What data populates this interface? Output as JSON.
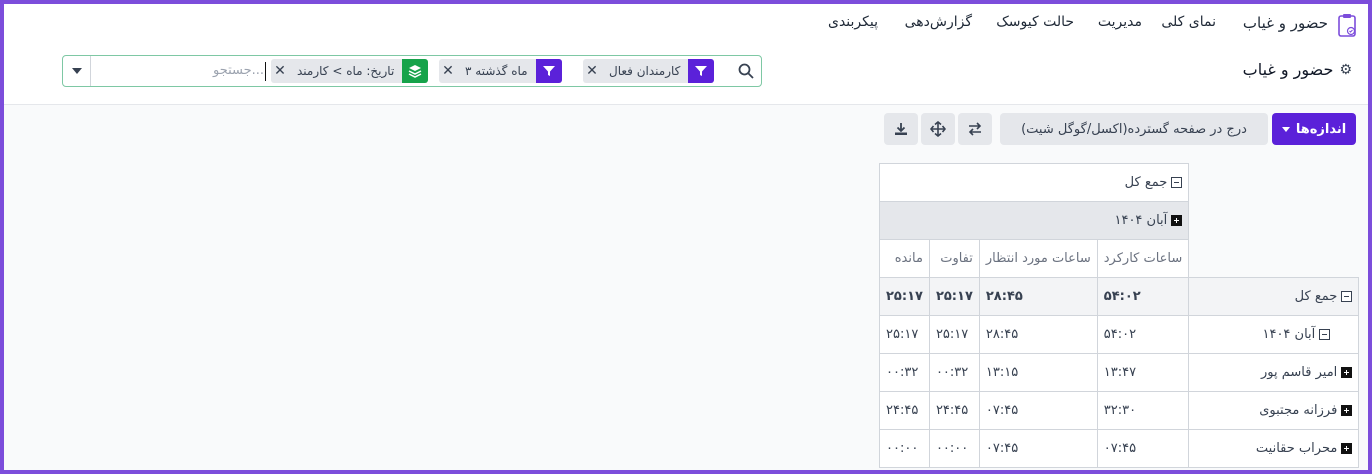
{
  "menu": {
    "app_title": "حضور و غیاب",
    "items": [
      "نمای کلی",
      "مدیریت",
      "حالت کیوسک",
      "گزارش‌دهی",
      "پیکربندی"
    ]
  },
  "breadcrumb": {
    "title": "حضور و غیاب"
  },
  "search": {
    "placeholder": "جستجو...",
    "facets": [
      {
        "label": "کارمندان فعال",
        "icon": "filter-icon",
        "color": "#5b21d9"
      },
      {
        "label": "۳ ماه گذشته",
        "icon": "filter-icon",
        "color": "#5b21d9"
      },
      {
        "label": "تاریخ: ماه > کارمند",
        "icon": "group-by-icon",
        "color": "#16a34a"
      }
    ]
  },
  "toolbar": {
    "measures_label": "اندازه‌ها",
    "spreadsheet_label": "درج در صفحه گسترده(اکسل/گوگل شیت)"
  },
  "pivot": {
    "col_total": "جمع کل",
    "col_month": "آبان ۱۴۰۴",
    "measures": [
      "ساعات کارکرد",
      "ساعات مورد انتظار",
      "تفاوت",
      "مانده"
    ],
    "rows": [
      {
        "label": "جمع کل",
        "icon": "minus",
        "values": [
          "۵۴:۰۲",
          "۲۸:۴۵",
          "۲۵:۱۷",
          "۲۵:۱۷"
        ],
        "bold": true
      },
      {
        "label": "آبان ۱۴۰۴",
        "icon": "minus",
        "values": [
          "۵۴:۰۲",
          "۲۸:۴۵",
          "۲۵:۱۷",
          "۲۵:۱۷"
        ],
        "bold": false
      },
      {
        "label": "امیر قاسم پور",
        "icon": "plus",
        "values": [
          "۱۳:۴۷",
          "۱۳:۱۵",
          "۰۰:۳۲",
          "۰۰:۳۲"
        ],
        "bold": false
      },
      {
        "label": "فرزانه مجتبوی",
        "icon": "plus",
        "values": [
          "۳۲:۳۰",
          "۰۷:۴۵",
          "۲۴:۴۵",
          "۲۴:۴۵"
        ],
        "bold": false
      },
      {
        "label": "محراب حقانیت",
        "icon": "plus",
        "values": [
          "۰۷:۴۵",
          "۰۷:۴۵",
          "۰۰:۰۰",
          "۰۰:۰۰"
        ],
        "bold": false
      }
    ]
  },
  "colors": {
    "accent": "#5b21d9",
    "group": "#16a34a",
    "frame": "#7c4ddb"
  }
}
